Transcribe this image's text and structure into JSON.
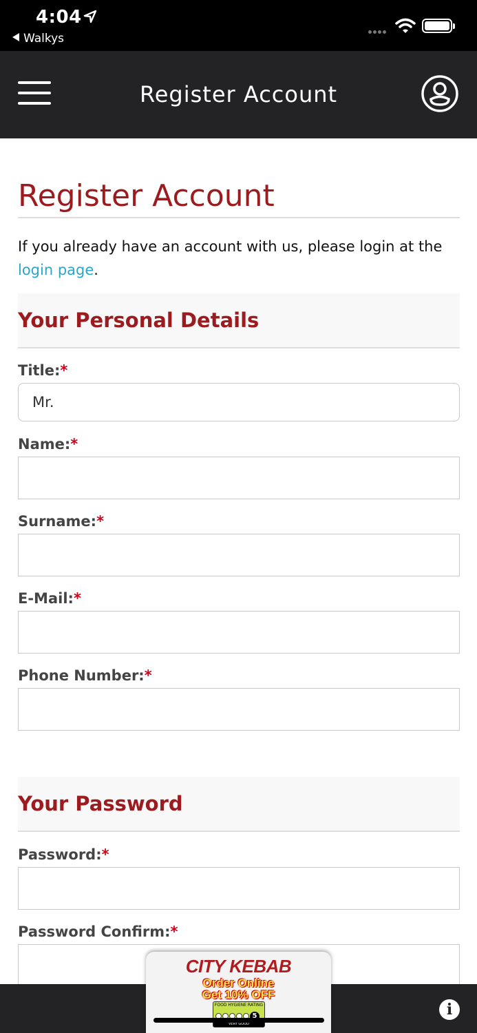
{
  "status_bar": {
    "time": "4:04",
    "back_app": "Walkys"
  },
  "header": {
    "title": "Register Account"
  },
  "page": {
    "heading": "Register Account",
    "intro_text": "If you already have an account with us, please login at the ",
    "intro_link": "login page",
    "intro_end": "."
  },
  "personal_section": {
    "heading": "Your Personal Details",
    "fields": [
      {
        "label": "Title:",
        "value": "Mr."
      },
      {
        "label": "Name:",
        "value": ""
      },
      {
        "label": "Surname:",
        "value": ""
      },
      {
        "label": "E-Mail:",
        "value": ""
      },
      {
        "label": "Phone Number:",
        "value": ""
      }
    ]
  },
  "password_section": {
    "heading": "Your Password",
    "fields": [
      {
        "label": "Password:",
        "value": ""
      },
      {
        "label": "Password Confirm:",
        "value": ""
      }
    ]
  },
  "required_marker": "*",
  "promo": {
    "brand": "CITY KEBAB",
    "line1": "Order Online",
    "line2": "Get 10% OFF",
    "hygiene_title": "FOOD HYGIENE RATING",
    "hygiene_dots": [
      "0",
      "1",
      "2",
      "3",
      "4"
    ],
    "hygiene_score": "5",
    "hygiene_label": "VERY GOOD"
  },
  "colors": {
    "accent": "#9b1b1f",
    "link": "#2aa6c8",
    "header_bg": "#232325",
    "required": "#d0021b"
  },
  "icons": {
    "menu": "hamburger-icon",
    "account": "account-icon",
    "info": "info-icon",
    "location": "location-arrow-icon",
    "wifi": "wifi-icon",
    "battery": "battery-icon"
  }
}
